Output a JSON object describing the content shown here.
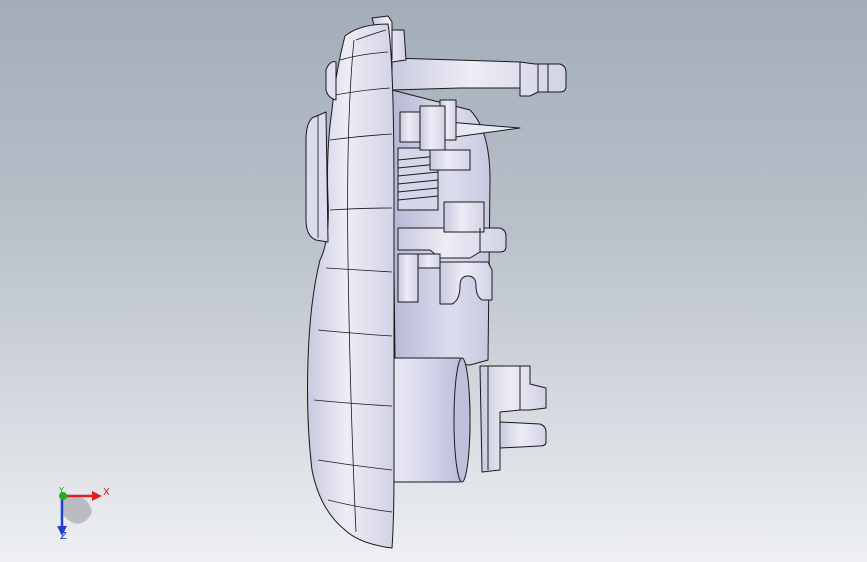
{
  "viewport": {
    "background_top": "#a3adb9",
    "background_bottom": "#eef0f3"
  },
  "model": {
    "shade_color": "#e6e6f2",
    "shade_dark": "#c4c4dc",
    "edge_color": "#1a1a1a"
  },
  "triad": {
    "x_label": "X",
    "y_label": "Y",
    "z_label": "Z",
    "x_color": "#e02020",
    "y_color": "#20b020",
    "z_color": "#2040d0"
  }
}
